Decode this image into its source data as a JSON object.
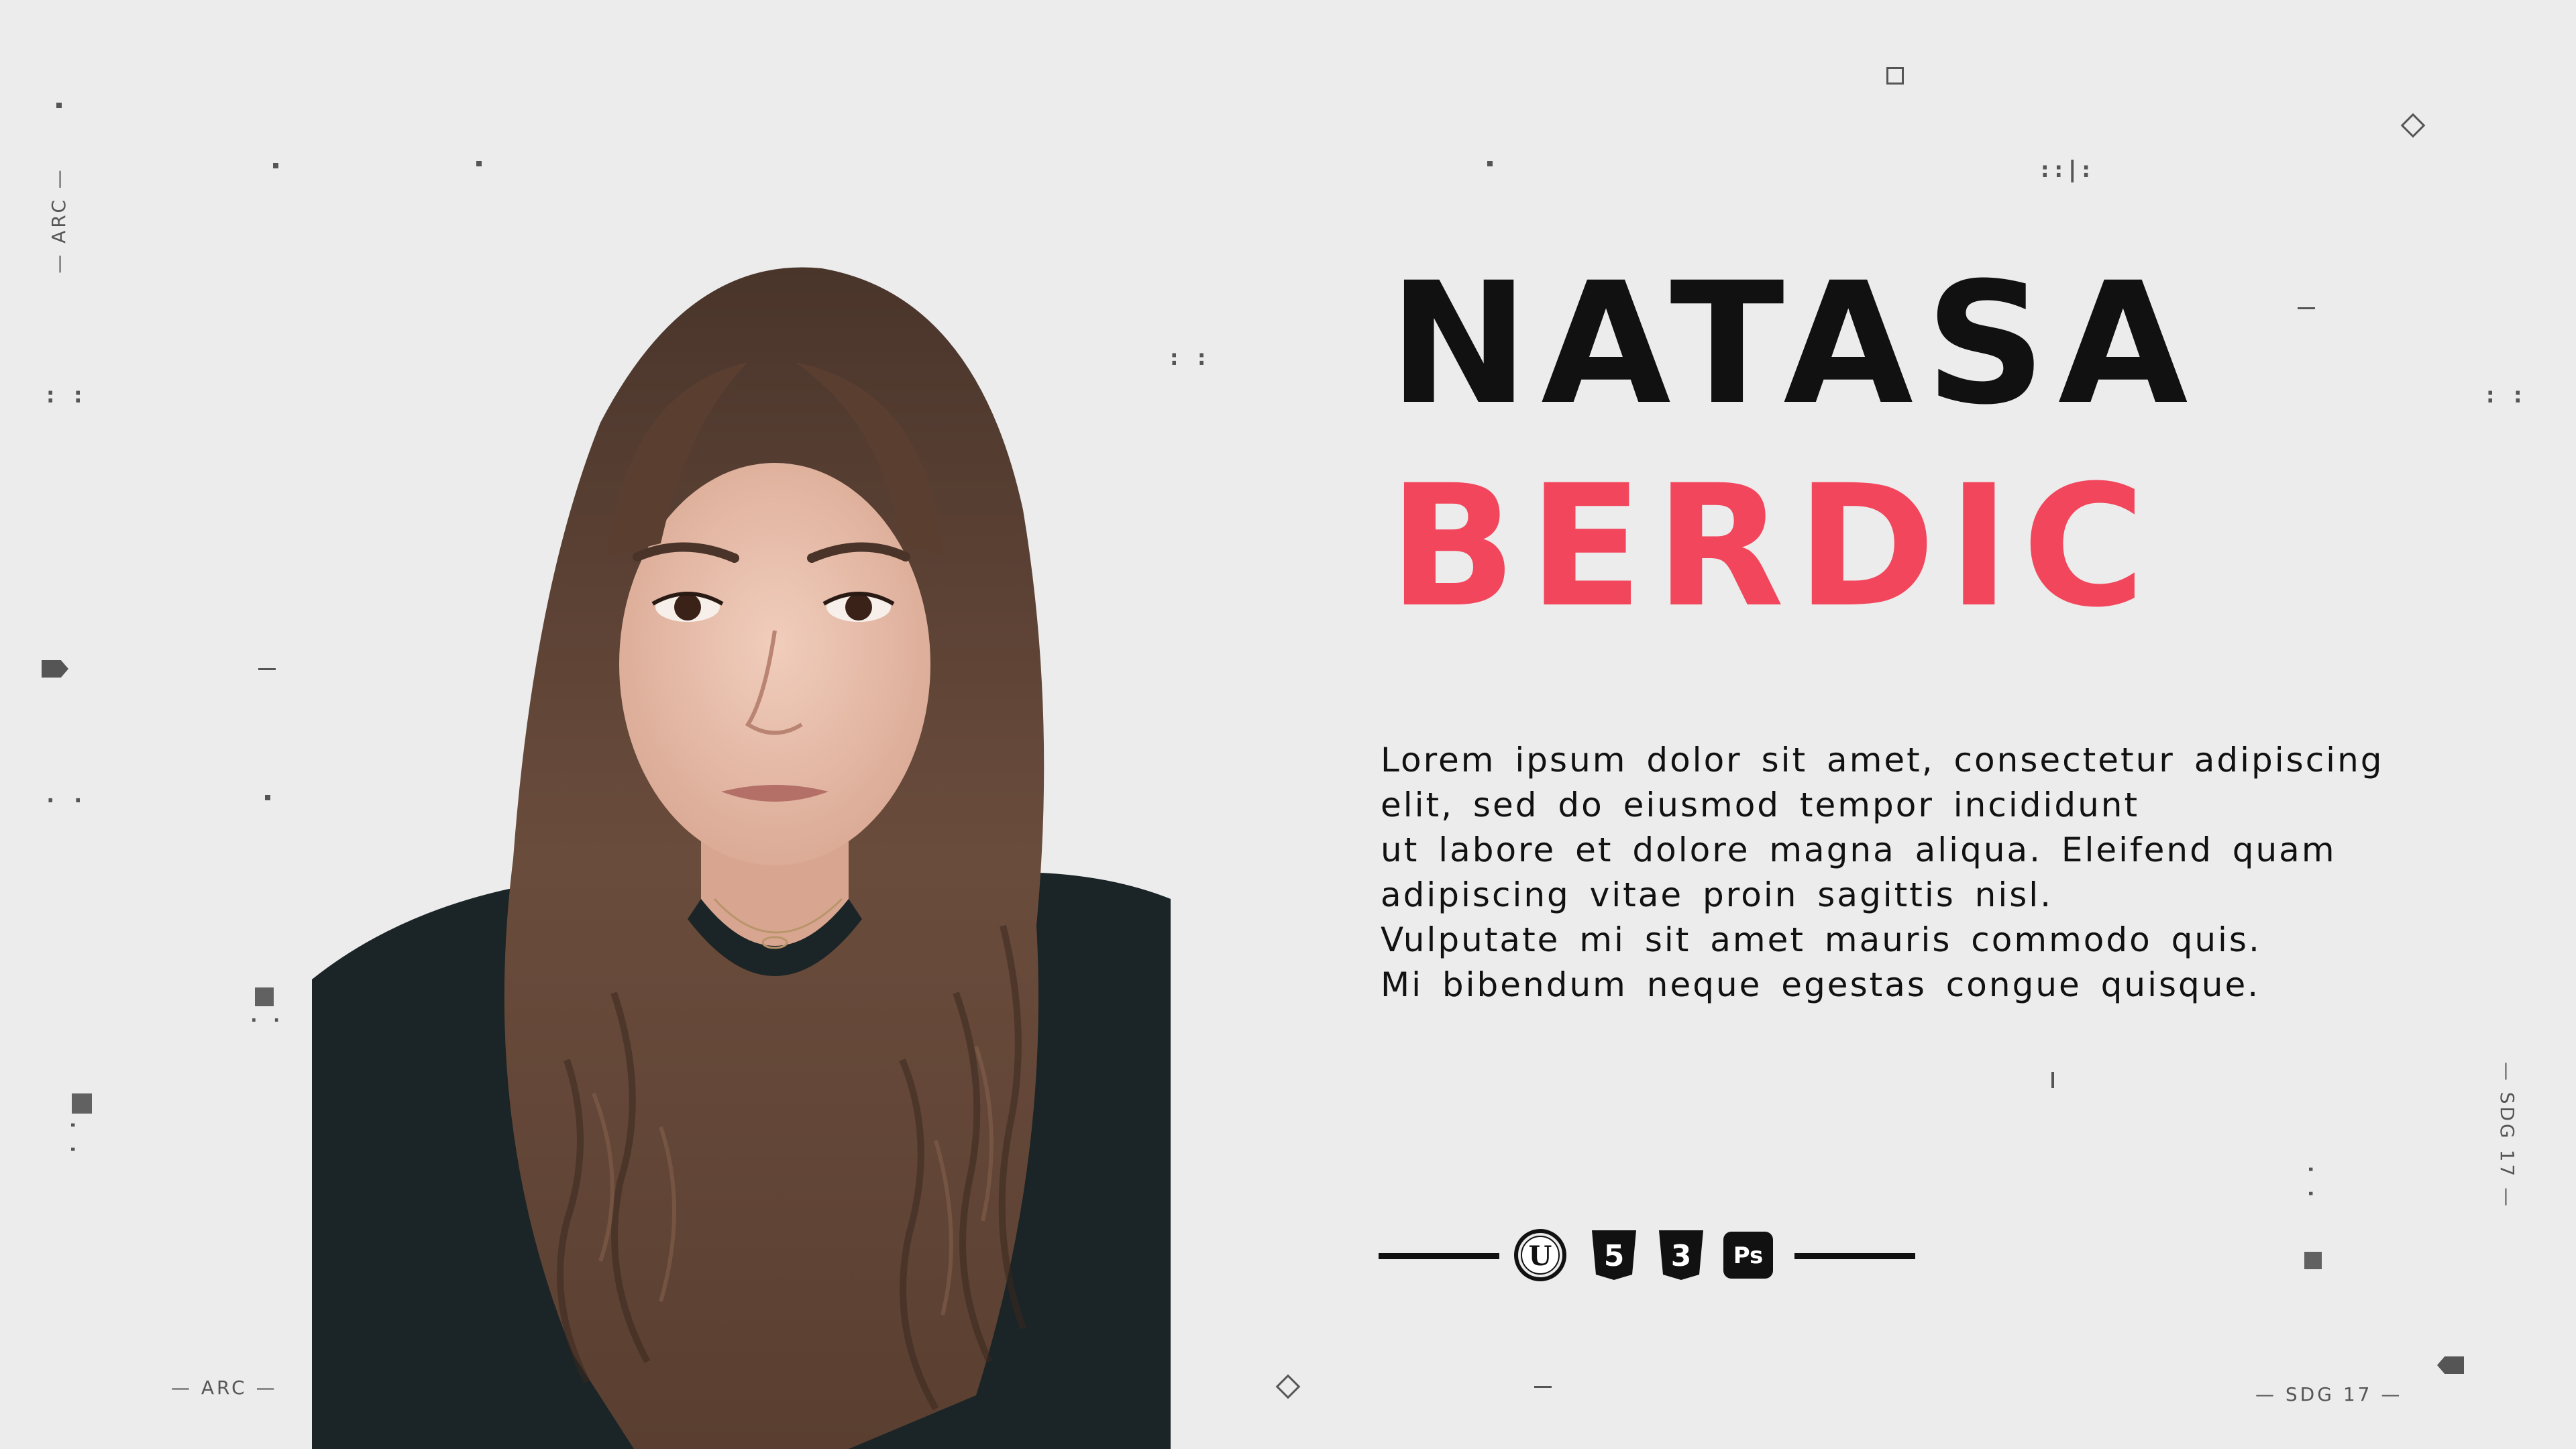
{
  "profile": {
    "first_name": "NATASA",
    "last_name": "BERDIC",
    "bio_lines": [
      "Lorem ipsum dolor sit amet, consectetur adipiscing",
      "elit, sed do eiusmod tempor incididunt",
      "ut labore et dolore magna aliqua. Eleifend quam",
      "adipiscing vitae proin sagittis nisl.",
      "Vulputate mi sit amet mauris commodo quis.",
      "Mi bibendum neque egestas congue quisque."
    ]
  },
  "skills": [
    {
      "name": "unreal-engine-icon",
      "label": "U"
    },
    {
      "name": "html5-icon",
      "label": "5"
    },
    {
      "name": "css3-icon",
      "label": "3"
    },
    {
      "name": "photoshop-icon",
      "label": "Ps"
    }
  ],
  "labels": {
    "left_vertical": "— ARC —",
    "left_bottom": "— ARC —",
    "right_vertical": "— SDG 17 —",
    "right_bottom": "— SDG 17 —"
  },
  "colors": {
    "background": "#ececec",
    "accent": "#f2465c",
    "text": "#111111"
  }
}
